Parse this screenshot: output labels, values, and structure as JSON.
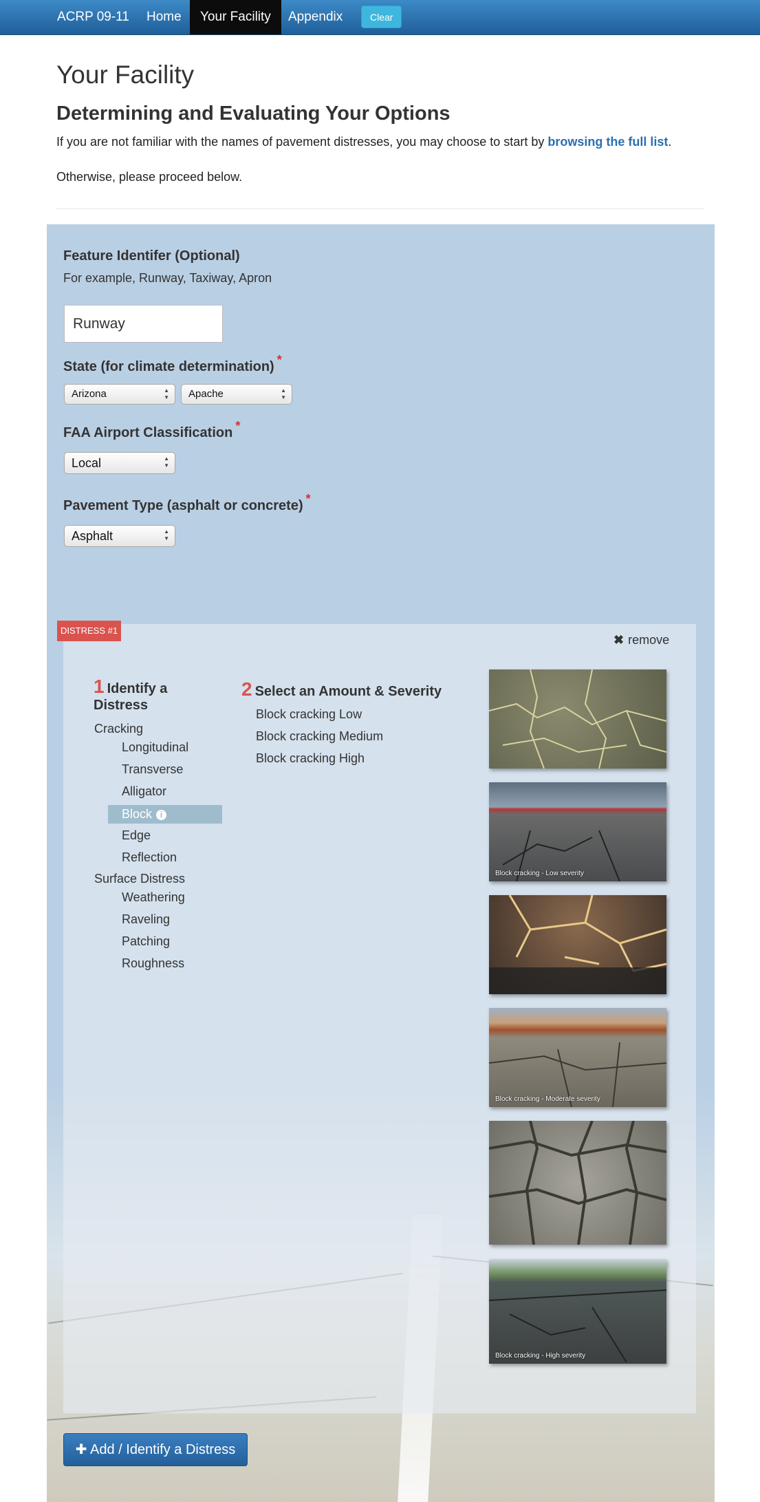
{
  "navbar": {
    "brand": "ACRP 09-11",
    "items": [
      "Home",
      "Your Facility",
      "Appendix"
    ],
    "clear_label": "Clear"
  },
  "header": {
    "title": "Your Facility",
    "subtitle": "Determining and Evaluating Your Options",
    "intro_prefix": "If you are not familiar with the names of pavement distresses, you may choose to start by ",
    "intro_link": "browsing the full list",
    "intro_suffix": ".",
    "intro2": "Otherwise, please proceed below."
  },
  "form": {
    "feature_label": "Feature Identifer (Optional)",
    "feature_help": "For example, Runway, Taxiway, Apron",
    "feature_value": "Runway",
    "state_label": "State (for climate determination)",
    "state_value": "Arizona",
    "county_value": "Apache",
    "faa_label": "FAA Airport Classification",
    "faa_value": "Local",
    "pavement_label": "Pavement Type (asphalt or concrete)",
    "pavement_value": "Asphalt",
    "required_mark": "*"
  },
  "distress": {
    "tag": "DISTRESS #1",
    "remove_label": "remove",
    "step1_num": "1",
    "step1_label": "Identify a Distress",
    "step2_num": "2",
    "step2_label": "Select an Amount & Severity",
    "categories": [
      {
        "name": "Cracking",
        "items": [
          "Longitudinal",
          "Transverse",
          "Alligator",
          "Block",
          "Edge",
          "Reflection"
        ]
      },
      {
        "name": "Surface Distress",
        "items": [
          "Weathering",
          "Raveling",
          "Patching",
          "Roughness"
        ]
      }
    ],
    "selected_item": "Block",
    "severities": [
      "Block cracking Low",
      "Block cracking Medium",
      "Block cracking High"
    ],
    "photo_captions": [
      "",
      "Block cracking - Low severity",
      "",
      "Block cracking - Moderate severity",
      "",
      "Block cracking - High severity"
    ]
  },
  "add_button": "Add / Identify a Distress",
  "colors": {
    "navbar": "#2b70ad",
    "accent_red": "#d9534f",
    "selected_bg": "#9fbccd",
    "link": "#2a6fb0",
    "panel": "#b9cfe4"
  }
}
